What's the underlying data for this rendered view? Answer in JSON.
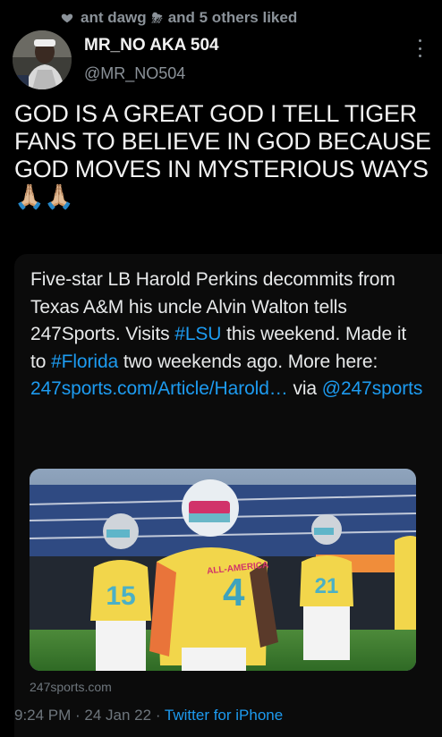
{
  "liked_by": {
    "user": "ant dawg",
    "emoji": "⛈",
    "suffix": "and 5 others liked"
  },
  "author": {
    "display_name": "MR_NO AKA 504",
    "handle": "@MR_NO504"
  },
  "tweet_text": "GOD IS A GREAT GOD I TELL TIGER FANS TO BELIEVE IN GOD BECAUSE GOD MOVES IN MYSTERIOUS WAYS🙏🏼🙏🏼",
  "quoted_tweet": {
    "text_1": "Five-star LB Harold Perkins decommits from Texas A&M his uncle Alvin Walton tells 247Sports. Visits ",
    "hashtag_1": "#LSU",
    "text_2": " this weekend. Made it to ",
    "hashtag_2": "#Florida",
    "text_3": " two weekends ago. More here: ",
    "link_url": "247sports.com/Article/Harold…",
    "text_4": " via ",
    "mention": "@247sports",
    "link_caption": "247sports.com",
    "jersey_text": "ALL-AMERICA",
    "jersey_number": "4"
  },
  "meta": {
    "time": "9:24 PM",
    "date": "24 Jan 22",
    "source": "Twitter for iPhone"
  },
  "colors": {
    "background": "#000000",
    "text": "#e7e9ea",
    "muted": "#8b9299",
    "link": "#1d9bf0",
    "jersey": "#f2d64b"
  }
}
